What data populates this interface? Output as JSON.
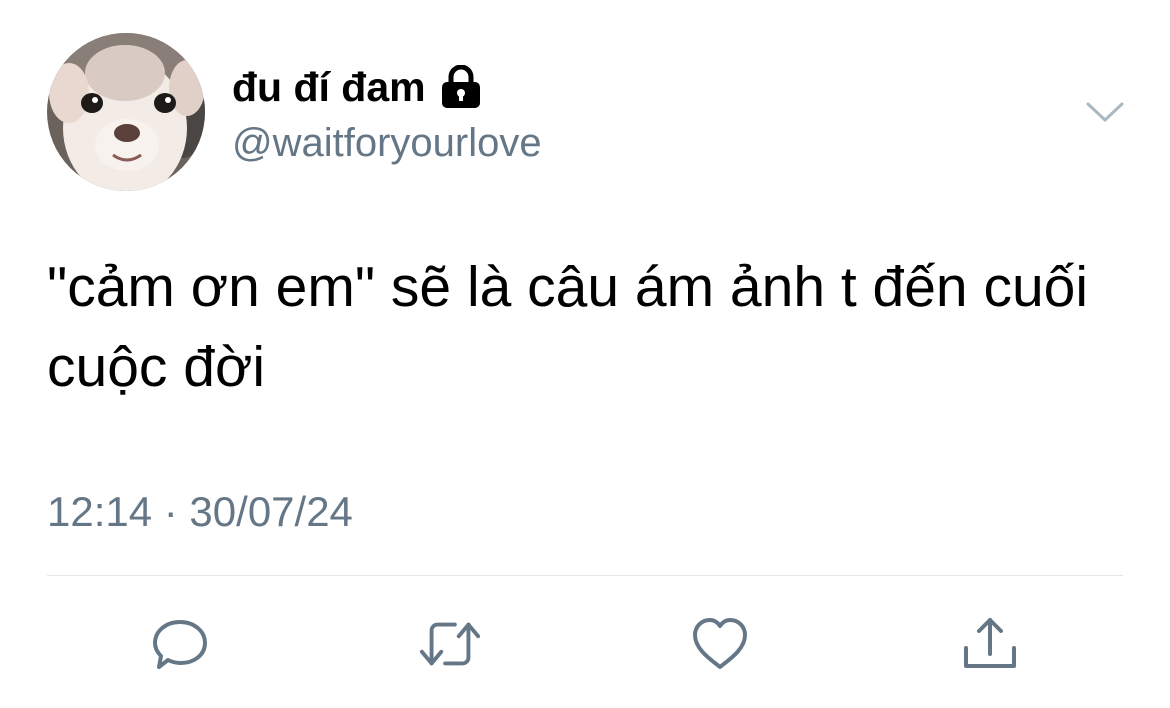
{
  "user": {
    "display_name": "đu đí đam",
    "handle": "@waitforyourlove",
    "protected": true
  },
  "tweet": {
    "text": "\"cảm ơn em\" sẽ là câu ám ảnh t đến cuối cuộc đời",
    "timestamp": "12:14 · 30/07/24"
  },
  "actions": [
    {
      "icon": "reply-icon"
    },
    {
      "icon": "retweet-icon"
    },
    {
      "icon": "like-icon"
    },
    {
      "icon": "share-icon"
    }
  ],
  "colors": {
    "text_primary": "#000000",
    "text_secondary": "#657786",
    "icon": "#657786",
    "divider": "#e1e8ed"
  }
}
